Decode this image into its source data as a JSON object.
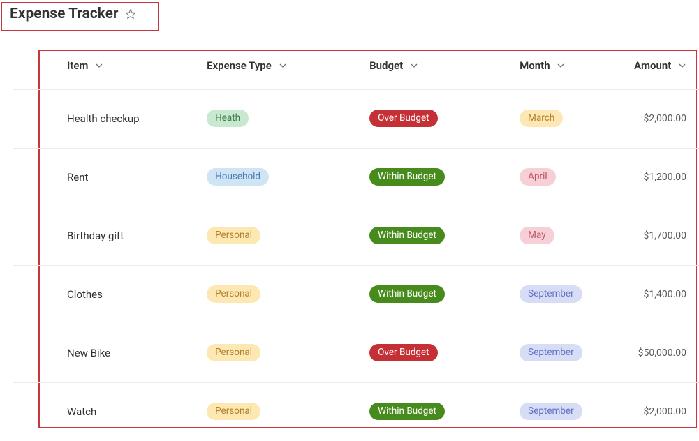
{
  "page": {
    "title": "Expense Tracker"
  },
  "columns": {
    "item": "Item",
    "expense_type": "Expense Type",
    "budget": "Budget",
    "month": "Month",
    "amount": "Amount"
  },
  "pill_colors": {
    "Heath": "#c8e8cf",
    "Household": "#cfe4f5",
    "Personal": "#fde7b2",
    "Over Budget": "#c43035",
    "Within Budget": "#468b1b",
    "March": "#fde7b2",
    "April": "#f7cfd6",
    "May": "#f7cfd6",
    "September": "#d6ddf5"
  },
  "rows": [
    {
      "item": "Health checkup",
      "expense_type": "Heath",
      "expense_type_class": "heath",
      "budget": "Over Budget",
      "budget_class": "over",
      "month": "March",
      "month_class": "m-march",
      "amount": "$2,000.00"
    },
    {
      "item": "Rent",
      "expense_type": "Household",
      "expense_type_class": "household",
      "budget": "Within Budget",
      "budget_class": "within",
      "month": "April",
      "month_class": "m-april",
      "amount": "$1,200.00"
    },
    {
      "item": "Birthday gift",
      "expense_type": "Personal",
      "expense_type_class": "personal",
      "budget": "Within Budget",
      "budget_class": "within",
      "month": "May",
      "month_class": "m-may",
      "amount": "$1,700.00"
    },
    {
      "item": "Clothes",
      "expense_type": "Personal",
      "expense_type_class": "personal",
      "budget": "Within Budget",
      "budget_class": "within",
      "month": "September",
      "month_class": "m-sept",
      "amount": "$1,400.00"
    },
    {
      "item": "New Bike",
      "expense_type": "Personal",
      "expense_type_class": "personal",
      "budget": "Over Budget",
      "budget_class": "over",
      "month": "September",
      "month_class": "m-sept",
      "amount": "$50,000.00"
    },
    {
      "item": "Watch",
      "expense_type": "Personal",
      "expense_type_class": "personal",
      "budget": "Within Budget",
      "budget_class": "within",
      "month": "September",
      "month_class": "m-sept",
      "amount": "$2,000.00"
    }
  ]
}
